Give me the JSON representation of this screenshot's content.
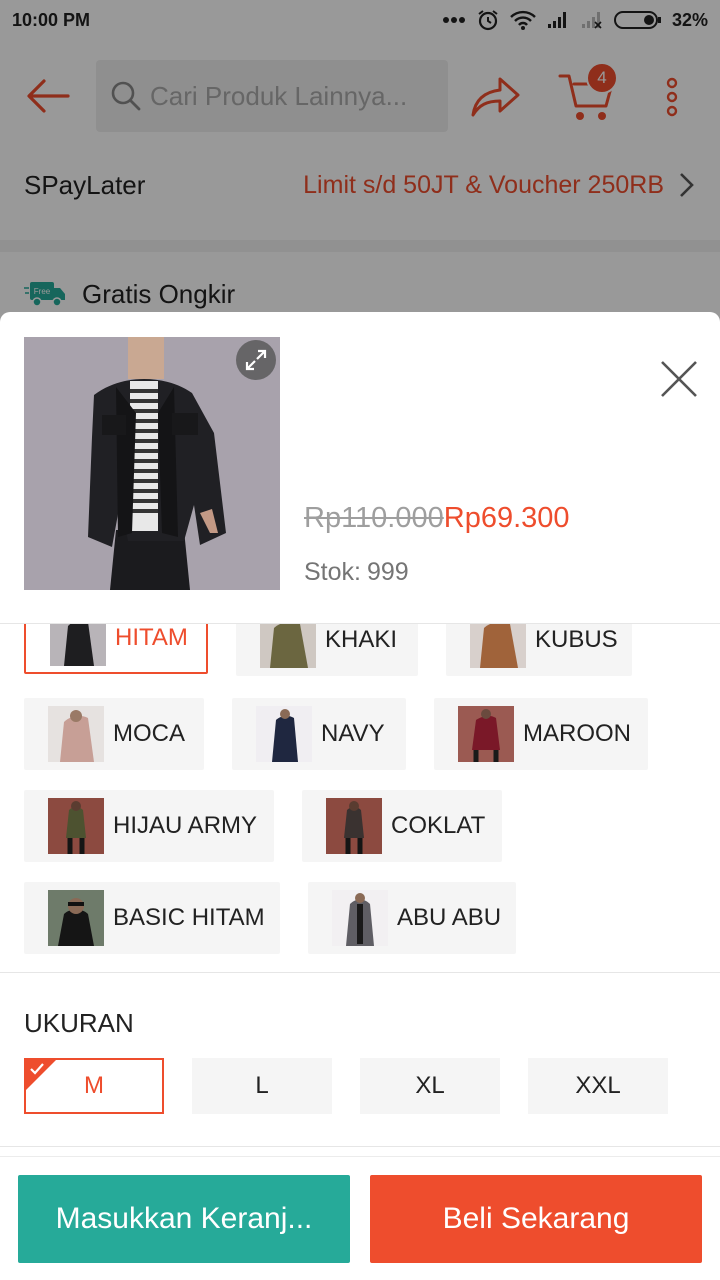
{
  "status_bar": {
    "time": "10:00 PM",
    "battery": "32%"
  },
  "header": {
    "search_placeholder": "Cari Produk Lainnya...",
    "cart_count": "4"
  },
  "background": {
    "spaylater_title": "SPayLater",
    "spaylater_promo": "Limit s/d 50JT & Voucher 250RB",
    "free_badge": "Free",
    "shipping_label": "Gratis Ongkir"
  },
  "product": {
    "old_price": "Rp110.000",
    "new_price": "Rp69.300",
    "stock_label": "Stok:",
    "stock_value": "999"
  },
  "variants": [
    {
      "label": "HITAM",
      "selected": true
    },
    {
      "label": "KHAKI",
      "selected": false
    },
    {
      "label": "KUBUS",
      "selected": false
    },
    {
      "label": "MOCA",
      "selected": false
    },
    {
      "label": "NAVY",
      "selected": false
    },
    {
      "label": "MAROON",
      "selected": false
    },
    {
      "label": "HIJAU ARMY",
      "selected": false
    },
    {
      "label": "COKLAT",
      "selected": false
    },
    {
      "label": "BASIC HITAM",
      "selected": false
    },
    {
      "label": "ABU ABU",
      "selected": false
    }
  ],
  "size": {
    "title": "UKURAN",
    "options": [
      {
        "label": "M",
        "selected": true
      },
      {
        "label": "L",
        "selected": false
      },
      {
        "label": "XL",
        "selected": false
      },
      {
        "label": "XXL",
        "selected": false
      }
    ]
  },
  "actions": {
    "add_to_cart": "Masukkan Keranj...",
    "buy_now": "Beli Sekarang"
  },
  "colors": {
    "accent": "#ee4d2d",
    "secondary": "#26aa99"
  }
}
